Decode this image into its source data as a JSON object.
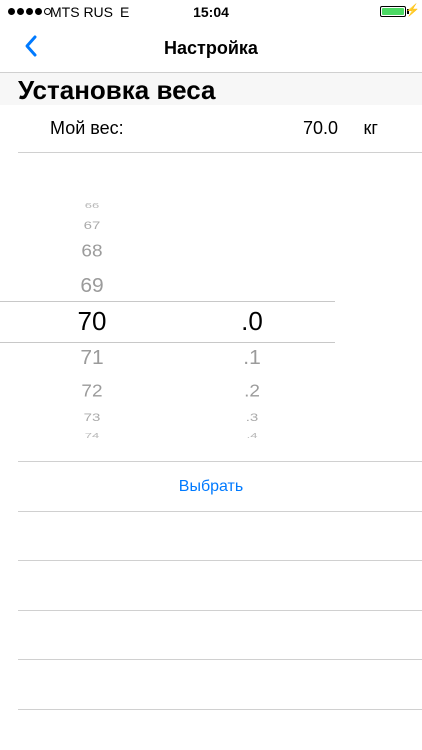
{
  "status_bar": {
    "carrier": "MTS RUS",
    "network": "E",
    "time": "15:04"
  },
  "nav": {
    "title": "Настройка",
    "back_icon": "chevron-left-icon"
  },
  "section": {
    "title": "Установка веса"
  },
  "weight_row": {
    "label": "Мой вес:",
    "value": "70.0",
    "unit": "кг"
  },
  "picker": {
    "integer": {
      "items": [
        "66",
        "67",
        "68",
        "69",
        "70",
        "71",
        "72",
        "73",
        "74"
      ],
      "selected": "70"
    },
    "decimal": {
      "items": [
        ".0",
        ".1",
        ".2",
        ".3",
        ".4"
      ],
      "selected": ".0"
    }
  },
  "action": {
    "choose_label": "Выбрать"
  },
  "colors": {
    "accent": "#007aff",
    "battery": "#4cd964"
  }
}
